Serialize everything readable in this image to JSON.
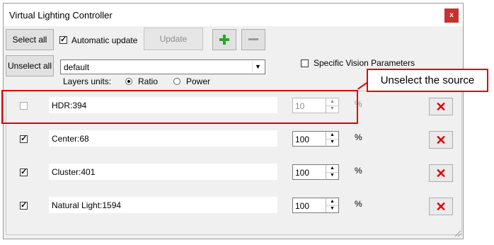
{
  "window": {
    "title": "Virtual Lighting Controller",
    "close_label": "x"
  },
  "toolbar": {
    "select_all": "Select all",
    "unselect_all": "Unselect all",
    "automatic_update_label": "Automatic update",
    "automatic_update_checked": true,
    "update": "Update",
    "add_icon": "plus-icon",
    "remove_icon": "minus-icon"
  },
  "preset": {
    "value": "default"
  },
  "vision": {
    "label": "Specific Vision Parameters",
    "checked": false
  },
  "units": {
    "label": "Layers units:",
    "options": [
      "Ratio",
      "Power"
    ],
    "selected": "Ratio"
  },
  "layers": [
    {
      "name": "HDR:394",
      "checked": false,
      "value": "10",
      "unit": "%"
    },
    {
      "name": "Center:68",
      "checked": true,
      "value": "100",
      "unit": "%"
    },
    {
      "name": "Cluster:401",
      "checked": true,
      "value": "100",
      "unit": "%"
    },
    {
      "name": "Natural Light:1594",
      "checked": true,
      "value": "100",
      "unit": "%"
    }
  ],
  "annotation": {
    "text": "Unselect the source"
  },
  "colors": {
    "accent": "#e00000",
    "close": "#c8312f",
    "add": "#2ba52b"
  }
}
